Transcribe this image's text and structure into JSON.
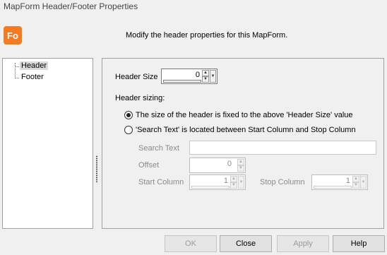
{
  "window": {
    "title": "MapForm Header/Footer Properties"
  },
  "logo": {
    "text": "Fo",
    "color": "#f47b20"
  },
  "subtitle": "Modify the header properties for this MapForm.",
  "tree": {
    "items": [
      {
        "label": "Header",
        "selected": true
      },
      {
        "label": "Footer",
        "selected": false
      }
    ]
  },
  "panel": {
    "header_size_label": "Header Size",
    "header_size_value": "0",
    "sizing_label": "Header sizing:",
    "radio_fixed_label": "The size of the header is fixed to the above 'Header Size' value",
    "radio_search_label": "'Search Text' is located between Start Column and Stop Column",
    "search_text_label": "Search Text",
    "search_text_value": "",
    "offset_label": "Offset",
    "offset_value": "0",
    "start_column_label": "Start Column",
    "start_column_value": "1",
    "stop_column_label": "Stop Column",
    "stop_column_value": "1"
  },
  "buttons": {
    "ok": "OK",
    "close": "Close",
    "apply": "Apply",
    "help": "Help"
  }
}
